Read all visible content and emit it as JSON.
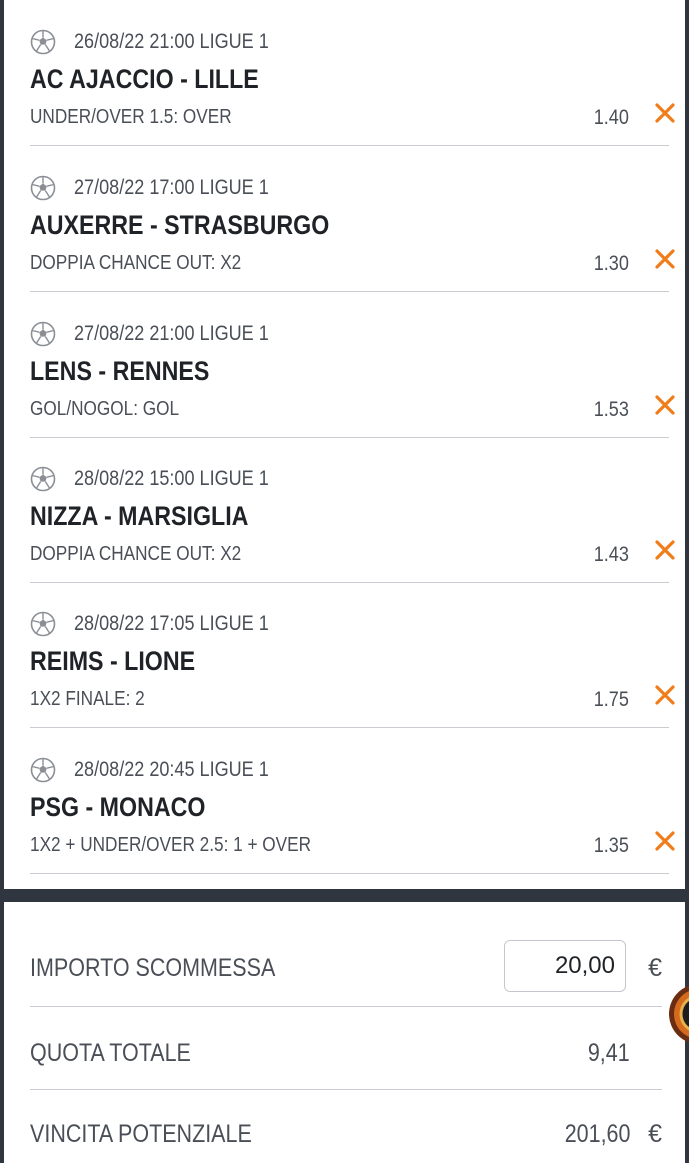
{
  "bets": [
    {
      "meta": "26/08/22 21:00 LIGUE 1",
      "match": "AC AJACCIO - LILLE",
      "market": "UNDER/OVER 1.5: OVER",
      "odd": "1.40"
    },
    {
      "meta": "27/08/22 17:00 LIGUE 1",
      "match": "AUXERRE - STRASBURGO",
      "market": "DOPPIA CHANCE OUT: X2",
      "odd": "1.30"
    },
    {
      "meta": "27/08/22 21:00 LIGUE 1",
      "match": "LENS - RENNES",
      "market": "GOL/NOGOL: GOL",
      "odd": "1.53"
    },
    {
      "meta": "28/08/22 15:00 LIGUE 1",
      "match": "NIZZA - MARSIGLIA",
      "market": "DOPPIA CHANCE OUT: X2",
      "odd": "1.43"
    },
    {
      "meta": "28/08/22 17:05 LIGUE 1",
      "match": "REIMS - LIONE",
      "market": "1X2 FINALE: 2",
      "odd": "1.75"
    },
    {
      "meta": "28/08/22 20:45 LIGUE 1",
      "match": "PSG - MONACO",
      "market": "1X2 + UNDER/OVER 2.5: 1 + OVER",
      "odd": "1.35"
    }
  ],
  "summary": {
    "stake_label": "IMPORTO SCOMMESSA",
    "stake_value": "20,00",
    "total_odds_label": "QUOTA TOTALE",
    "total_odds_value": "9,41",
    "potential_win_label": "VINCITA POTENZIALE",
    "potential_win_value": "201,60",
    "currency": "€"
  },
  "icons": {
    "sport": "soccer-ball-icon",
    "remove": "close-icon",
    "casino": "roulette-icon"
  },
  "colors": {
    "accent": "#f07d1a",
    "text": "#1f2226",
    "muted": "#4a4f57",
    "frame": "#2f3640"
  }
}
